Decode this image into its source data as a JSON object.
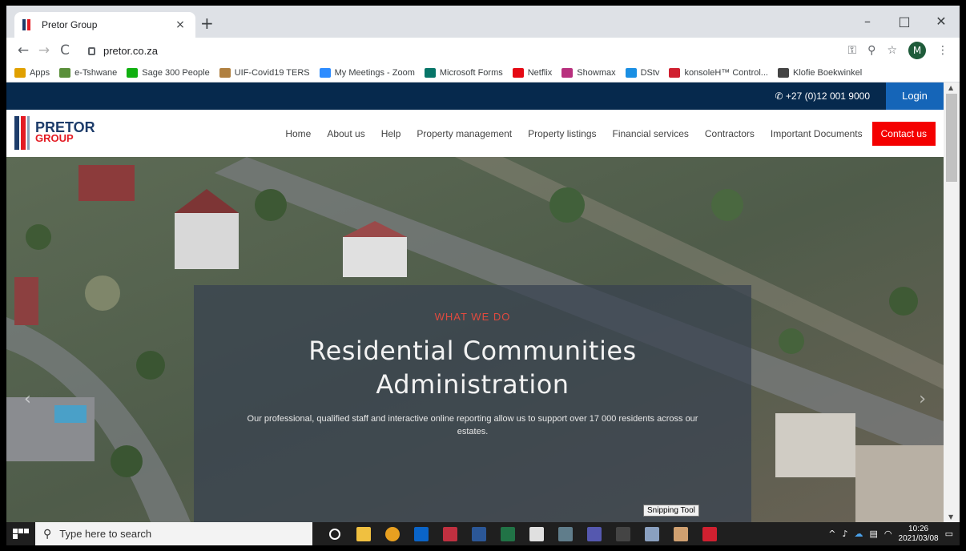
{
  "browser": {
    "tab_title": "Pretor Group",
    "tab_close": "×",
    "new_tab": "+",
    "url": "pretor.co.za",
    "profile_initial": "M",
    "window_controls": [
      "–",
      "□",
      "✕"
    ],
    "nav_back": "←",
    "nav_forward": "→",
    "nav_reload": "C"
  },
  "bookmarks": [
    {
      "label": "Apps",
      "icon": "apps-grid-icon",
      "color": "#e0a000"
    },
    {
      "label": "e-Tshwane",
      "icon": "etshwane-icon",
      "color": "#5a8f3a"
    },
    {
      "label": "Sage 300 People",
      "icon": "sage-icon",
      "color": "#10b010"
    },
    {
      "label": "UIF-Covid19 TERS",
      "icon": "uif-icon",
      "color": "#b08040"
    },
    {
      "label": "My Meetings - Zoom",
      "icon": "zoom-icon",
      "color": "#2d8cff"
    },
    {
      "label": "Microsoft Forms",
      "icon": "forms-icon",
      "color": "#077568"
    },
    {
      "label": "Netflix",
      "icon": "netflix-icon",
      "color": "#e50914"
    },
    {
      "label": "Showmax",
      "icon": "showmax-icon",
      "color": "#b8307e"
    },
    {
      "label": "DStv",
      "icon": "dstv-icon",
      "color": "#1a8fe3"
    },
    {
      "label": "konsoleH™ Control...",
      "icon": "konsoleh-icon",
      "color": "#d02030"
    },
    {
      "label": "Klofie Boekwinkel",
      "icon": "globe-icon",
      "color": "#444444"
    }
  ],
  "site": {
    "phone": "+27 (0)12 001 9000",
    "login": "Login",
    "logo_line1": "PRETOR",
    "logo_line2": "GROUP",
    "menu": [
      "Home",
      "About us",
      "Help",
      "Property management",
      "Property listings",
      "Financial services",
      "Contractors",
      "Important Documents"
    ],
    "contact": "Contact us",
    "colors": {
      "navy": "#06294d",
      "login_blue": "#1565b8",
      "red": "#f40000"
    }
  },
  "hero": {
    "eyebrow": "WHAT WE DO",
    "title_line1": "Residential Communities",
    "title_line2": "Administration",
    "desc": "Our professional, qualified staff and interactive online reporting allow us to support over 17 000 residents across our estates.",
    "prev": "‹",
    "next": "›"
  },
  "taskbar": {
    "search_placeholder": "Type here to search",
    "tooltip": "Snipping Tool",
    "time": "10:26",
    "date": "2021/03/08"
  }
}
